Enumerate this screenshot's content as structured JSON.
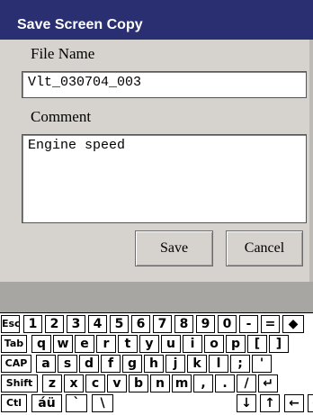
{
  "dialog": {
    "title": "Save Screen Copy",
    "file_name_label": "File Name",
    "file_name_value": "Vlt_030704_003",
    "comment_label": "Comment",
    "comment_value": "Engine speed",
    "save_label": "Save",
    "cancel_label": "Cancel"
  },
  "keyboard": {
    "rows": [
      [
        "Esc",
        "1",
        "2",
        "3",
        "4",
        "5",
        "6",
        "7",
        "8",
        "9",
        "0",
        "-",
        "=",
        "◆"
      ],
      [
        "Tab",
        "q",
        "w",
        "e",
        "r",
        "t",
        "y",
        "u",
        "i",
        "o",
        "p",
        "[",
        "]"
      ],
      [
        "CAP",
        "a",
        "s",
        "d",
        "f",
        "g",
        "h",
        "j",
        "k",
        "l",
        ";",
        "'"
      ],
      [
        "Shift",
        "z",
        "x",
        "c",
        "v",
        "b",
        "n",
        "m",
        ",",
        ".",
        "/",
        "↵"
      ],
      [
        "Ctl",
        "áü",
        "`",
        "\\",
        "↓",
        "↑",
        "←",
        "→"
      ]
    ]
  }
}
